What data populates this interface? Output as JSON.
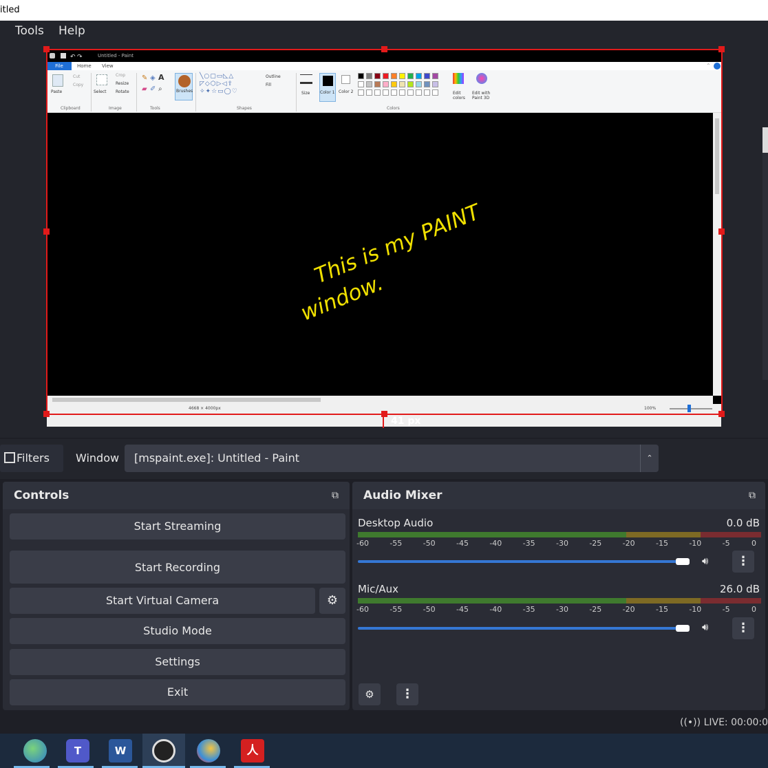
{
  "window_title": "itled",
  "menu": [
    "Tools",
    "Help"
  ],
  "paint": {
    "title": "Untitled - Paint",
    "tabs": [
      "File",
      "Home",
      "View"
    ],
    "groups": [
      "Clipboard",
      "Image",
      "Tools",
      "Shapes",
      "Colors"
    ],
    "buttons": {
      "paste": "Paste",
      "cut": "Cut",
      "copy": "Copy",
      "select": "Select",
      "crop": "Crop",
      "resize": "Resize",
      "rotate": "Rotate",
      "brushes": "Brushes",
      "outline": "Outline",
      "fill": "Fill",
      "size": "Size",
      "color1": "Color 1",
      "color2": "Color 2",
      "edit_colors": "Edit colors",
      "edit_paint3d": "Edit with Paint 3D"
    },
    "canvas_text_line1": "This is my PAINT",
    "canvas_text_line2": "window.",
    "status_size": "4668 × 4000px",
    "zoom": "100%"
  },
  "crop_label": "41 px",
  "filters_button": "Filters",
  "window_label": "Window",
  "window_source": "[mspaint.exe]: Untitled - Paint",
  "controls": {
    "title": "Controls",
    "buttons": [
      "Start Streaming",
      "Start Recording",
      "Start Virtual Camera",
      "Studio Mode",
      "Settings",
      "Exit"
    ]
  },
  "audio_mixer": {
    "title": "Audio Mixer",
    "scale": [
      "-60",
      "-55",
      "-50",
      "-45",
      "-40",
      "-35",
      "-30",
      "-25",
      "-20",
      "-15",
      "-10",
      "-5",
      "0"
    ],
    "channels": [
      {
        "name": "Desktop Audio",
        "db": "0.0 dB",
        "volume": 0.93
      },
      {
        "name": "Mic/Aux",
        "db": "26.0 dB",
        "volume": 0.93
      }
    ]
  },
  "live_status": "LIVE: 00:00:0",
  "colors": {
    "accent": "#3577d4",
    "selection": "#e21a1a",
    "canvas_text": "#f0e000",
    "panel": "#2a2c35",
    "button": "#3a3d48"
  },
  "taskbar_icons": [
    "earth-app-icon",
    "teams-icon",
    "word-icon",
    "obs-icon",
    "paint-icon",
    "acrobat-icon"
  ]
}
